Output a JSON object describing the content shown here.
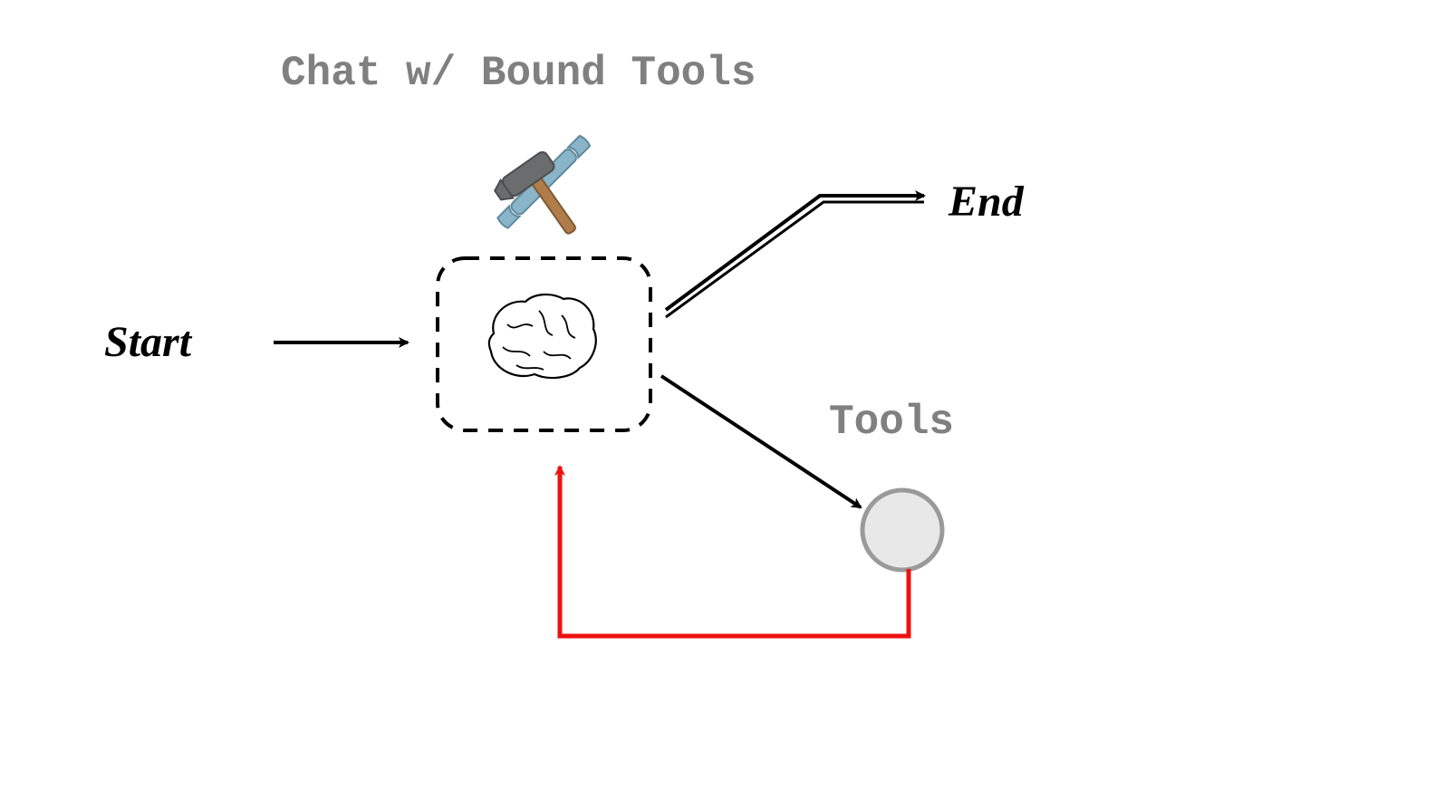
{
  "title": "Chat w/ Bound Tools",
  "nodes": {
    "start": {
      "label": "Start"
    },
    "end": {
      "label": "End"
    },
    "tools": {
      "label": "Tools"
    },
    "agent": {
      "label": "Agent (brain)"
    }
  },
  "icons": {
    "hammer_wrench": "hammer-wrench-icon",
    "brain": "brain-icon",
    "tool_node": "circle-node"
  },
  "edges": [
    {
      "from": "start",
      "to": "agent",
      "color": "black"
    },
    {
      "from": "agent",
      "to": "end",
      "color": "black",
      "style": "double"
    },
    {
      "from": "agent",
      "to": "tools",
      "color": "black"
    },
    {
      "from": "tools",
      "to": "agent",
      "color": "red"
    }
  ],
  "colors": {
    "text_gray": "#808080",
    "text_black": "#000000",
    "arrow_black": "#000000",
    "arrow_red": "#e11",
    "wrench_blue": "#8ab4c7",
    "hammer_handle": "#b07d4a",
    "hammer_head": "#6b6c6e",
    "circle_fill": "#e8e8e8",
    "circle_stroke": "#9a9a9a"
  }
}
